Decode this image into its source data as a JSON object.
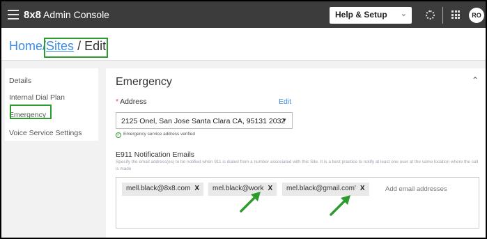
{
  "topbar": {
    "brand_bold": "8x8",
    "brand_text": "Admin Console",
    "help_label": "Help & Setup",
    "avatar_initials": "RO"
  },
  "breadcrumb": {
    "home": "Home",
    "sep1": "/",
    "sites": "Sites",
    "sep2": "/",
    "current": "Edit"
  },
  "sidebar": {
    "items": [
      {
        "label": "Details"
      },
      {
        "label": "Internal Dial Plan"
      },
      {
        "label": "Emergency"
      },
      {
        "label": "Voice Service Settings"
      }
    ]
  },
  "emergency": {
    "title": "Emergency",
    "address_required_mark": "*",
    "address_label": "Address",
    "edit_label": "Edit",
    "address_value": "2125 Onel, San Jose Santa Clara CA, 95131 2032",
    "verified_text": "Emergency service address verified",
    "e911_title": "E911 Notification Emails",
    "e911_description": "Specify the email address(es) to be notified when 911 is dialed from a number associated with this Site. It is a best practice to notify at least one user at the same location where the call is made",
    "emails": [
      "mell.black@8x8.com",
      "mel.black@work",
      "mel.black@gmail.com'"
    ],
    "remove_label": "X",
    "add_placeholder": "Add email addresses"
  },
  "annotation_color": "#2e9b2e"
}
